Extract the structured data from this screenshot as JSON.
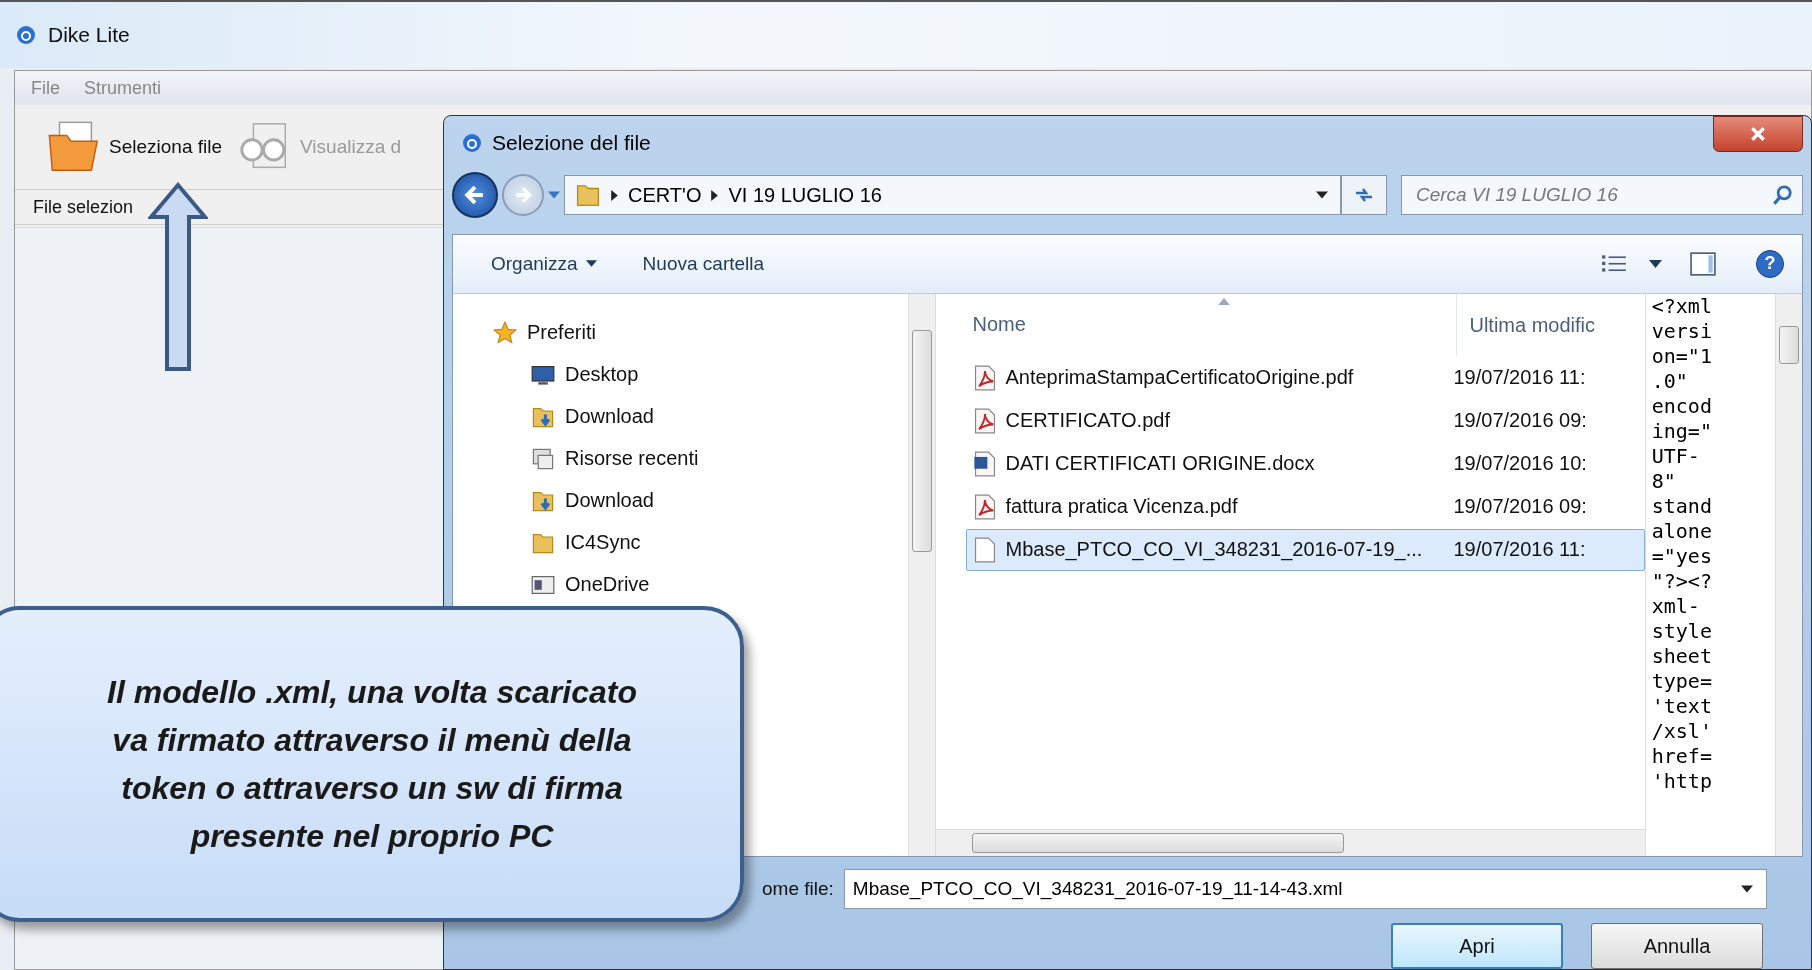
{
  "app": {
    "title": "Dike Lite",
    "menu": [
      {
        "label": "File"
      },
      {
        "label": "Strumenti"
      }
    ],
    "toolbar": [
      {
        "label": "Seleziona file",
        "disabled": false
      },
      {
        "label": "Visualizza d",
        "disabled": true
      }
    ],
    "selected_files_label": "File selezion"
  },
  "dialog": {
    "title": "Selezione del file",
    "breadcrumb": [
      "CERT'O",
      "VI 19 LUGLIO 16"
    ],
    "search": {
      "placeholder": "Cerca VI 19 LUGLIO 16"
    },
    "commands": [
      "Organizza",
      "Nuova cartella"
    ],
    "help": "?",
    "nav": [
      {
        "label": "Preferiti",
        "kind": "favorites",
        "children": [
          {
            "label": "Desktop",
            "kind": "desktop"
          },
          {
            "label": "Download",
            "kind": "download"
          },
          {
            "label": "Risorse recenti",
            "kind": "recent"
          },
          {
            "label": "Download",
            "kind": "download"
          },
          {
            "label": "IC4Sync",
            "kind": "folder"
          },
          {
            "label": "OneDrive",
            "kind": "onedrive"
          }
        ]
      }
    ],
    "columns": [
      "Nome",
      "Ultima modific"
    ],
    "files": [
      {
        "name": "AnteprimaStampaCertificatoOrigine.pdf",
        "date": "19/07/2016 11:",
        "kind": "pdf",
        "selected": false
      },
      {
        "name": "CERTIFICATO.pdf",
        "date": "19/07/2016 09:",
        "kind": "pdf",
        "selected": false
      },
      {
        "name": "DATI CERTIFICATI ORIGINE.docx",
        "date": "19/07/2016 10:",
        "kind": "docx",
        "selected": false
      },
      {
        "name": "fattura pratica Vicenza.pdf",
        "date": "19/07/2016 09:",
        "kind": "pdf",
        "selected": false
      },
      {
        "name": "Mbase_PTCO_CO_VI_348231_2016-07-19_...",
        "date": "19/07/2016 11:",
        "kind": "file",
        "selected": true
      }
    ],
    "preview": [
      "<?xml",
      "versi",
      "on=\"1",
      ".0\"",
      "encod",
      "ing=\"",
      "UTF-",
      "8\"",
      "stand",
      "alone",
      "=\"yes",
      "\"?><?",
      "xml-",
      "style",
      "sheet",
      "type=",
      "'text",
      "/xsl'",
      "href=",
      "'http"
    ],
    "filename_label": "ome file:",
    "filename": "Mbase_PTCO_CO_VI_348231_2016-07-19_11-14-43.xml",
    "buttons": [
      {
        "label": "Apri",
        "default": true
      },
      {
        "label": "Annulla",
        "default": false
      }
    ]
  },
  "callout": {
    "lines": [
      "Il modello .xml, una volta scaricato",
      "va firmato  attraverso il menù della",
      "token o attraverso un sw di firma",
      "presente nel proprio PC"
    ]
  }
}
